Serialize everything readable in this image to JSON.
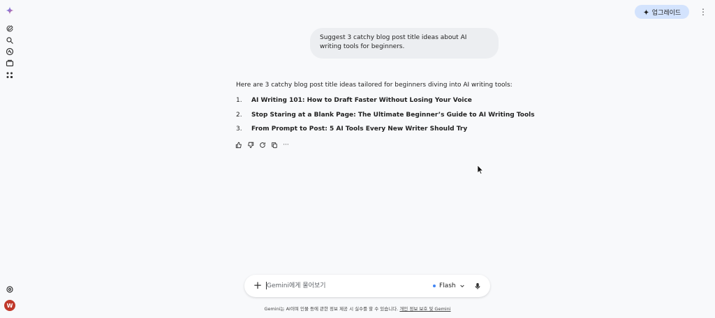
{
  "header": {
    "upgrade_label": "업그레이드"
  },
  "chat": {
    "user_message": "Suggest 3 catchy blog post title ideas about AI writing tools for beginners.",
    "response_intro": "Here are 3 catchy blog post title ideas tailored for beginners diving into AI writing tools:",
    "items": [
      {
        "num": "1.",
        "title": "AI Writing 101: How to Draft Faster Without Losing Your Voice"
      },
      {
        "num": "2.",
        "title": "Stop Staring at a Blank Page: The Ultimate Beginner’s Guide to AI Writing Tools"
      },
      {
        "num": "3.",
        "title": "From Prompt to Post: 5 AI Tools Every New Writer Should Try"
      }
    ],
    "more_label": "···"
  },
  "input": {
    "placeholder": "Gemini에게 물어보기",
    "model_label": "Flash"
  },
  "footer": {
    "disclaimer": "Gemini는 AI이며 인물 등에 관한 정보 제공 시 실수를 할 수 있습니다.",
    "link_label": "개인 정보 보호 및 Gemini"
  },
  "user": {
    "avatar_initial": "W"
  },
  "colors": {
    "upgrade_bg": "#d3e3fd",
    "avatar_bg": "#c0392b",
    "flash_dot": "#4285f4"
  }
}
